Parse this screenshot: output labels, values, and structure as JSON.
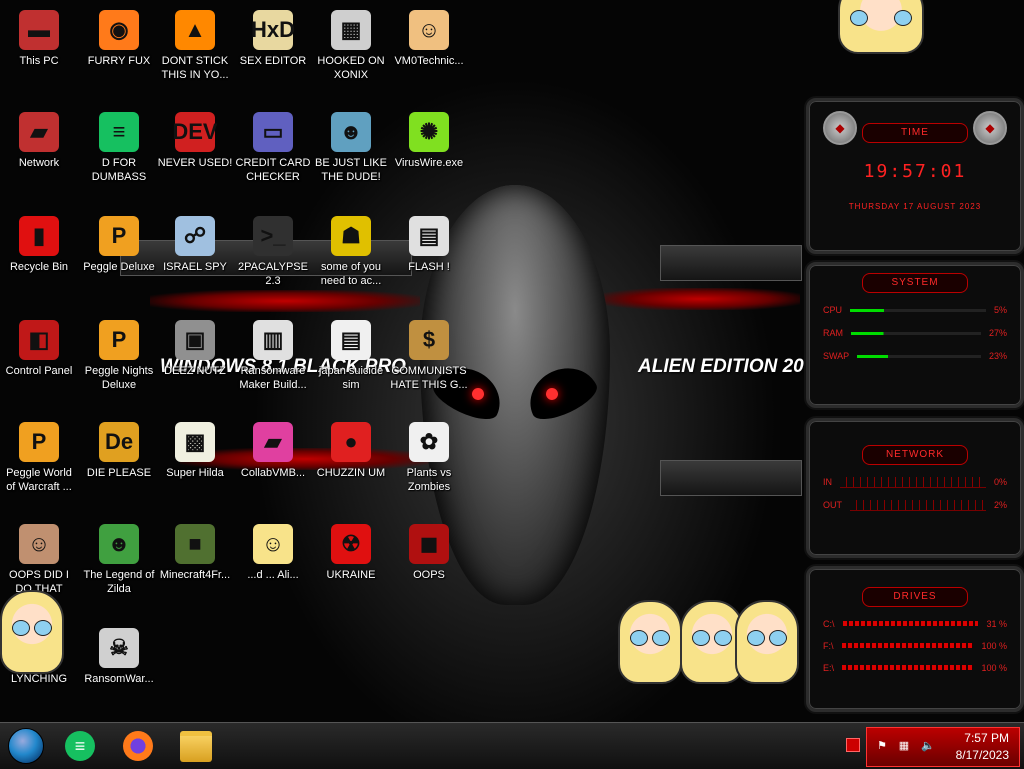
{
  "wallpaper": {
    "text_left": "WINDOWS 8.1 BLACK PRO",
    "text_right": "ALIEN EDITION 20"
  },
  "icons": [
    {
      "label": "This PC",
      "glyph": "▬",
      "color": "#c03030"
    },
    {
      "label": "FURRY FUX",
      "glyph": "◉",
      "color": "#ff7a1a"
    },
    {
      "label": "DONT STICK THIS IN YO...",
      "glyph": "▲",
      "color": "#ff8800"
    },
    {
      "label": "SEX EDITOR",
      "glyph": "HxD",
      "color": "#e8d8a0"
    },
    {
      "label": "HOOKED ON XONIX",
      "glyph": "▦",
      "color": "#cfcfcf"
    },
    {
      "label": "VM0Technic...",
      "glyph": "☺",
      "color": "#f0c080"
    },
    {
      "label": "Network",
      "glyph": "▰",
      "color": "#c03030"
    },
    {
      "label": "D FOR DUMBASS",
      "glyph": "≡",
      "color": "#16c060"
    },
    {
      "label": "NEVER USED!",
      "glyph": "DEV",
      "color": "#d02020"
    },
    {
      "label": "CREDIT CARD CHECKER",
      "glyph": "▭",
      "color": "#6060c0"
    },
    {
      "label": "BE JUST LIKE THE DUDE!",
      "glyph": "☻",
      "color": "#60a0c0"
    },
    {
      "label": "VirusWire.exe",
      "glyph": "✺",
      "color": "#80e020"
    },
    {
      "label": "Recycle Bin",
      "glyph": "▮",
      "color": "#e01010"
    },
    {
      "label": "Peggle Deluxe",
      "glyph": "P",
      "color": "#f0a020"
    },
    {
      "label": "ISRAEL SPY",
      "glyph": "☍",
      "color": "#a0c0e0"
    },
    {
      "label": "2PACALYPSE 2.3",
      "glyph": ">_",
      "color": "#303030"
    },
    {
      "label": "some of you need to ac...",
      "glyph": "☗",
      "color": "#e0c000"
    },
    {
      "label": "FLASH !",
      "glyph": "▤",
      "color": "#e0e0e0"
    },
    {
      "label": "Control Panel",
      "glyph": "◧",
      "color": "#c01818"
    },
    {
      "label": "Peggle Nights Deluxe",
      "glyph": "P",
      "color": "#f0a020"
    },
    {
      "label": "DEEZ NUTZ",
      "glyph": "▣",
      "color": "#909090"
    },
    {
      "label": "Ransomware Maker Build...",
      "glyph": "▥",
      "color": "#e0e0e0"
    },
    {
      "label": "japan suicide sim",
      "glyph": "▤",
      "color": "#f0f0f0"
    },
    {
      "label": "COMMUNISTS HATE THIS G...",
      "glyph": "$",
      "color": "#c09040"
    },
    {
      "label": "Peggle World of Warcraft ...",
      "glyph": "P",
      "color": "#f0a020"
    },
    {
      "label": "DIE PLEASE",
      "glyph": "De",
      "color": "#e0a020"
    },
    {
      "label": "Super Hilda",
      "glyph": "▩",
      "color": "#f0f0e0"
    },
    {
      "label": "CollabVMB...",
      "glyph": "▰",
      "color": "#e040a0"
    },
    {
      "label": "CHUZZIN UM",
      "glyph": "●",
      "color": "#e02020"
    },
    {
      "label": "Plants vs Zombies",
      "glyph": "✿",
      "color": "#f0f0f0"
    },
    {
      "label": "OOPS DID I DO THAT",
      "glyph": "☺",
      "color": "#c09070"
    },
    {
      "label": "The Legend of Zilda",
      "glyph": "☻",
      "color": "#40a040"
    },
    {
      "label": "Minecraft4Fr...",
      "glyph": "■",
      "color": "#507030"
    },
    {
      "label": "...d ... Ali...",
      "glyph": "☺",
      "color": "#f8e38a"
    },
    {
      "label": "UKRAINE",
      "glyph": "☢",
      "color": "#e01010"
    },
    {
      "label": "OOPS",
      "glyph": "◼",
      "color": "#b01010"
    },
    {
      "label": "LYNCHING",
      "glyph": "◎",
      "color": "#d0d0d0"
    },
    {
      "label": "RansomWar...",
      "glyph": "☠",
      "color": "#d0d0d0"
    }
  ],
  "widgets": {
    "time": {
      "title": "TIME",
      "clock": "19:57:01",
      "date": "THURSDAY 17 AUGUST 2023"
    },
    "system": {
      "title": "SYSTEM",
      "rows": [
        {
          "name": "CPU",
          "value": "5%"
        },
        {
          "name": "RAM",
          "value": "27%"
        },
        {
          "name": "SWAP",
          "value": "23%"
        }
      ]
    },
    "network": {
      "title": "NETWORK",
      "rows": [
        {
          "name": "IN",
          "value": "0%"
        },
        {
          "name": "OUT",
          "value": "2%"
        }
      ]
    },
    "drives": {
      "title": "DRIVES",
      "rows": [
        {
          "name": "C:\\",
          "value": "31 %"
        },
        {
          "name": "F:\\",
          "value": "100 %"
        },
        {
          "name": "E:\\",
          "value": "100 %"
        }
      ]
    }
  },
  "taskbar": {
    "items": [
      {
        "name": "start-button",
        "icon": "start-orb"
      },
      {
        "name": "taskbar-app-green",
        "icon": "≡"
      },
      {
        "name": "taskbar-firefox",
        "icon": "◉"
      },
      {
        "name": "taskbar-file-explorer",
        "icon": "▭"
      }
    ],
    "tray": {
      "time": "7:57 PM",
      "date": "8/17/2023"
    }
  }
}
